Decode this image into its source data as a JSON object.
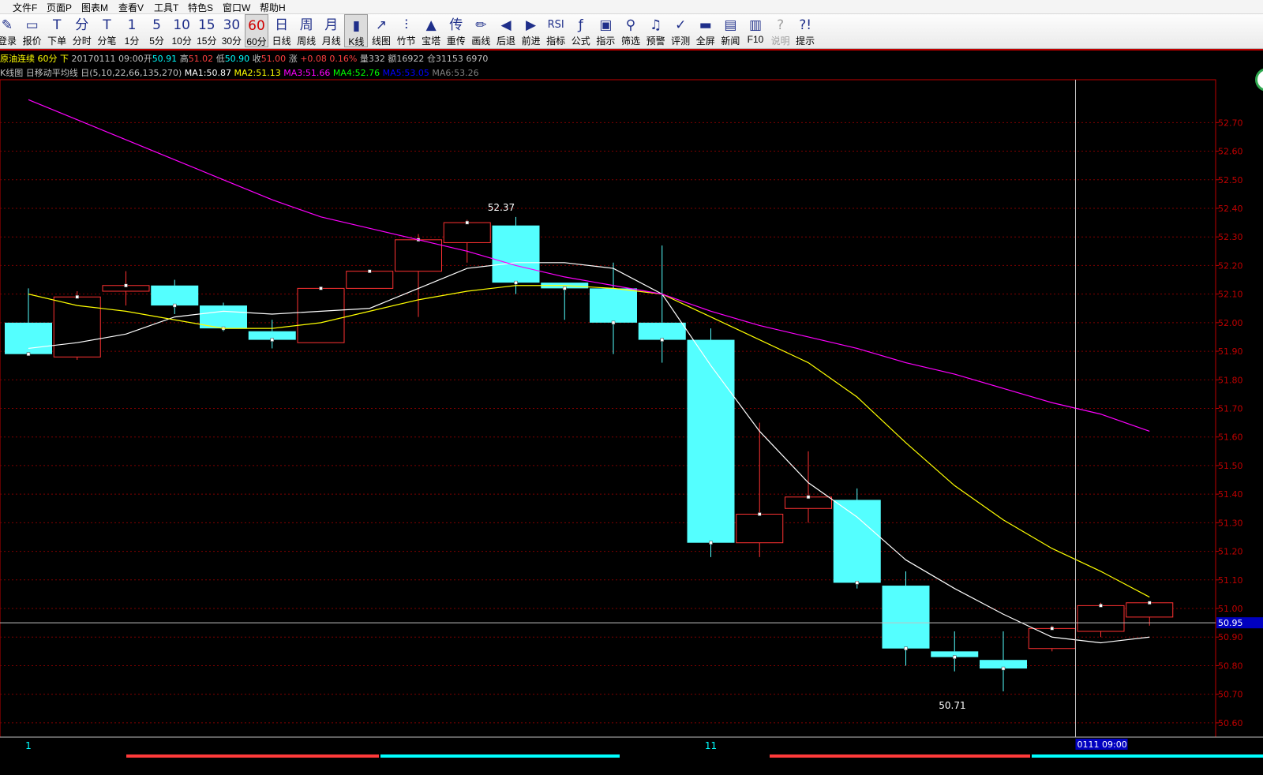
{
  "menu": [
    "文件F",
    "页面P",
    "图表M",
    "查看V",
    "工具T",
    "特色S",
    "窗口W",
    "帮助H"
  ],
  "toolbar": [
    {
      "icon": "✎",
      "label": "登录",
      "name": "login"
    },
    {
      "icon": "▭",
      "label": "报价",
      "name": "quote"
    },
    {
      "icon": "T",
      "label": "下单",
      "name": "order"
    },
    {
      "icon": "分",
      "label": "分时",
      "name": "timeshare"
    },
    {
      "icon": "T",
      "label": "分笔",
      "name": "tick"
    },
    {
      "icon": "1",
      "label": "1分",
      "name": "1min"
    },
    {
      "icon": "5",
      "label": "5分",
      "name": "5min"
    },
    {
      "icon": "10",
      "label": "10分",
      "name": "10min"
    },
    {
      "icon": "15",
      "label": "15分",
      "name": "15min"
    },
    {
      "icon": "30",
      "label": "30分",
      "name": "30min"
    },
    {
      "icon": "60",
      "label": "60分",
      "name": "60min",
      "selected": true
    },
    {
      "icon": "日",
      "label": "日线",
      "name": "daily"
    },
    {
      "icon": "周",
      "label": "周线",
      "name": "weekly"
    },
    {
      "icon": "月",
      "label": "月线",
      "name": "monthly"
    },
    {
      "icon": "▮",
      "label": "K线",
      "name": "kline",
      "selected": true
    },
    {
      "icon": "↗",
      "label": "线图",
      "name": "linechart"
    },
    {
      "icon": "⫶",
      "label": "竹节",
      "name": "bamboo"
    },
    {
      "icon": "▲",
      "label": "宝塔",
      "name": "tower"
    },
    {
      "icon": "传",
      "label": "重传",
      "name": "reload"
    },
    {
      "icon": "✏",
      "label": "画线",
      "name": "draw"
    },
    {
      "icon": "◀",
      "label": "后退",
      "name": "back"
    },
    {
      "icon": "▶",
      "label": "前进",
      "name": "forward"
    },
    {
      "icon": "RSI",
      "label": "指标",
      "name": "indicator"
    },
    {
      "icon": "ƒ",
      "label": "公式",
      "name": "formula"
    },
    {
      "icon": "▣",
      "label": "指示",
      "name": "signal"
    },
    {
      "icon": "⚲",
      "label": "筛选",
      "name": "filter"
    },
    {
      "icon": "♫",
      "label": "预警",
      "name": "alert"
    },
    {
      "icon": "✓",
      "label": "评测",
      "name": "evaluate"
    },
    {
      "icon": "▬",
      "label": "全屏",
      "name": "fullscreen"
    },
    {
      "icon": "▤",
      "label": "新闻",
      "name": "news"
    },
    {
      "icon": "▥",
      "label": "F10",
      "name": "f10"
    },
    {
      "icon": "?",
      "label": "说明",
      "name": "help",
      "disabled": true
    },
    {
      "icon": "?!",
      "label": "提示",
      "name": "tips"
    }
  ],
  "info_line1": {
    "symbol": "原油连续",
    "period": "60分",
    "arrow": "下",
    "datetime": "20170111 09:00",
    "open_label": "开",
    "open": "50.91",
    "high_label": "高",
    "high": "51.02",
    "low_label": "低",
    "low": "50.90",
    "close_label": "收",
    "close": "51.00",
    "change_label": "涨",
    "change": "+0.08",
    "change_pct": "0.16%",
    "volume_label": "量",
    "volume": "332",
    "amount_label": "额",
    "amount": "16922",
    "oi_label": "仓",
    "oi": "31153",
    "oi_change": "6970"
  },
  "info_line2": {
    "prefix": "K线图 日移动平均线 日(5,10,22,66,135,270)",
    "ma1": "MA1:50.87",
    "ma2": "MA2:51.13",
    "ma3": "MA3:51.66",
    "ma4": "MA4:52.76",
    "ma5": "MA5:53.05",
    "ma6": "MA6:53.26"
  },
  "colors": {
    "up": "#ff3232",
    "down": "#54ffff",
    "ma1": "#ffffff",
    "ma2": "#ffff00",
    "ma3": "#ff00ff",
    "ma4": "#00ff00",
    "ma5": "#0000ff",
    "ma6": "#808080",
    "grid": "#800000",
    "axis": "#c00000"
  },
  "chart_data": {
    "type": "candlestick",
    "ylim": [
      50.55,
      52.85
    ],
    "yticks": [
      "52.70",
      "52.60",
      "52.50",
      "52.40",
      "52.30",
      "52.20",
      "52.10",
      "52.00",
      "51.90",
      "51.80",
      "51.70",
      "51.60",
      "51.50",
      "51.40",
      "51.30",
      "51.20",
      "51.10",
      "51.00",
      "50.90",
      "50.80",
      "50.70",
      "50.60"
    ],
    "grid": true,
    "x_labels": [
      {
        "index": 0,
        "text": "1"
      },
      {
        "index": 14,
        "text": "11"
      }
    ],
    "cursor": {
      "index": 22,
      "price": 50.95,
      "price_label": "50.95",
      "time_label": "0111 09:00"
    },
    "annotations": [
      {
        "index": 9,
        "price": 52.37,
        "text": "52.37"
      },
      {
        "index": 19,
        "price": 50.71,
        "text": "50.71"
      }
    ],
    "candles": [
      {
        "o": 52.0,
        "h": 52.12,
        "l": 51.89,
        "c": 51.89
      },
      {
        "o": 51.88,
        "h": 52.11,
        "l": 51.87,
        "c": 52.09
      },
      {
        "o": 52.11,
        "h": 52.18,
        "l": 52.06,
        "c": 52.13
      },
      {
        "o": 52.13,
        "h": 52.15,
        "l": 52.03,
        "c": 52.06
      },
      {
        "o": 52.06,
        "h": 52.07,
        "l": 51.97,
        "c": 51.98
      },
      {
        "o": 51.97,
        "h": 52.01,
        "l": 51.91,
        "c": 51.94
      },
      {
        "o": 51.93,
        "h": 52.12,
        "l": 51.93,
        "c": 52.12
      },
      {
        "o": 52.12,
        "h": 52.18,
        "l": 52.12,
        "c": 52.18
      },
      {
        "o": 52.18,
        "h": 52.31,
        "l": 52.02,
        "c": 52.29
      },
      {
        "o": 52.28,
        "h": 52.36,
        "l": 52.21,
        "c": 52.35
      },
      {
        "o": 52.34,
        "h": 52.37,
        "l": 52.1,
        "c": 52.14
      },
      {
        "o": 52.14,
        "h": 52.14,
        "l": 52.01,
        "c": 52.12
      },
      {
        "o": 52.12,
        "h": 52.21,
        "l": 51.89,
        "c": 52.0
      },
      {
        "o": 52.0,
        "h": 52.27,
        "l": 51.86,
        "c": 51.94
      },
      {
        "o": 51.94,
        "h": 51.98,
        "l": 51.18,
        "c": 51.23
      },
      {
        "o": 51.23,
        "h": 51.65,
        "l": 51.18,
        "c": 51.33
      },
      {
        "o": 51.35,
        "h": 51.55,
        "l": 51.3,
        "c": 51.39
      },
      {
        "o": 51.38,
        "h": 51.42,
        "l": 51.07,
        "c": 51.09
      },
      {
        "o": 51.08,
        "h": 51.13,
        "l": 50.8,
        "c": 50.86
      },
      {
        "o": 50.85,
        "h": 50.92,
        "l": 50.78,
        "c": 50.83
      },
      {
        "o": 50.82,
        "h": 50.92,
        "l": 50.71,
        "c": 50.79
      },
      {
        "o": 50.86,
        "h": 50.94,
        "l": 50.85,
        "c": 50.93
      },
      {
        "o": 50.92,
        "h": 51.02,
        "l": 50.9,
        "c": 51.01
      },
      {
        "o": 50.97,
        "h": 51.02,
        "l": 50.94,
        "c": 51.02
      }
    ],
    "series": [
      {
        "name": "MA1",
        "color": "#ffffff",
        "values": [
          51.91,
          51.93,
          51.96,
          52.02,
          52.04,
          52.03,
          52.04,
          52.05,
          52.12,
          52.19,
          52.21,
          52.21,
          52.19,
          52.1,
          51.85,
          51.62,
          51.44,
          51.32,
          51.17,
          51.07,
          50.98,
          50.9,
          50.88,
          50.9
        ]
      },
      {
        "name": "MA2",
        "color": "#ffff00",
        "values": [
          52.1,
          52.06,
          52.04,
          52.01,
          51.98,
          51.98,
          52.0,
          52.04,
          52.08,
          52.11,
          52.13,
          52.13,
          52.12,
          52.1,
          52.02,
          51.94,
          51.86,
          51.74,
          51.58,
          51.43,
          51.31,
          51.21,
          51.13,
          51.04
        ]
      },
      {
        "name": "MA3",
        "color": "#ff00ff",
        "values": [
          52.78,
          52.71,
          52.64,
          52.57,
          52.5,
          52.43,
          52.37,
          52.33,
          52.29,
          52.25,
          52.2,
          52.16,
          52.13,
          52.1,
          52.04,
          51.99,
          51.95,
          51.91,
          51.86,
          51.82,
          51.77,
          51.72,
          51.68,
          51.62
        ]
      }
    ]
  },
  "bottom_tabs": [
    "",
    "",
    "",
    "",
    "",
    ""
  ]
}
